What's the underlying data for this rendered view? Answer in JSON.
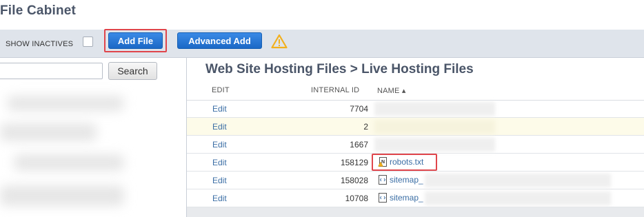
{
  "page": {
    "title": "File Cabinet"
  },
  "toolbar": {
    "show_inactives_label": "SHOW INACTIVES",
    "add_file_label": "Add File",
    "advanced_add_label": "Advanced Add",
    "warning_icon": "warning-triangle-icon"
  },
  "search": {
    "placeholder": "",
    "button_label": "Search"
  },
  "folder": {
    "path": "Web Site Hosting Files > Live Hosting Files"
  },
  "table": {
    "headers": {
      "edit": "EDIT",
      "internal_id": "INTERNAL ID",
      "name": "NAME ▴"
    },
    "rows": [
      {
        "edit": "Edit",
        "internal_id": "7704",
        "name": ""
      },
      {
        "edit": "Edit",
        "internal_id": "2",
        "name": ""
      },
      {
        "edit": "Edit",
        "internal_id": "1667",
        "name": ""
      },
      {
        "edit": "Edit",
        "internal_id": "158129",
        "name": "robots.txt"
      },
      {
        "edit": "Edit",
        "internal_id": "158028",
        "name": "sitemap_"
      },
      {
        "edit": "Edit",
        "internal_id": "10708",
        "name": "sitemap_"
      }
    ]
  },
  "colors": {
    "primary_button": "#1e74d6",
    "highlight_border": "#e0454b",
    "toolbar_bg": "#dfe4eb",
    "warning": "#f2b01e",
    "link": "#3b6ea5"
  }
}
